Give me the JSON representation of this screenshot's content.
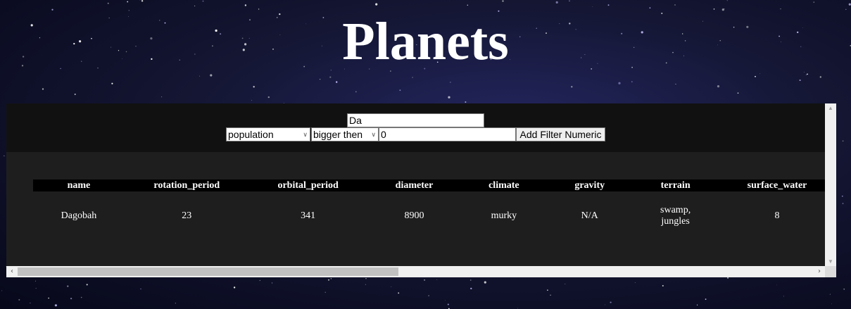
{
  "page": {
    "title": "Planets"
  },
  "filters": {
    "name_value": "Da",
    "column_selected": "population",
    "comparison_selected": "bigger then",
    "value": "0",
    "add_button_label": "Add Filter Numeric"
  },
  "table": {
    "headers": [
      "name",
      "rotation_period",
      "orbital_period",
      "diameter",
      "climate",
      "gravity",
      "terrain",
      "surface_water"
    ],
    "rows": [
      [
        "Dagobah",
        "23",
        "341",
        "8900",
        "murky",
        "N/A",
        "swamp, jungles",
        "8"
      ]
    ]
  },
  "icons": {
    "dropdown": "chevron-down-icon",
    "scroll_left": "chevron-left-icon",
    "scroll_right": "chevron-right-icon",
    "scroll_up": "triangle-up-icon",
    "scroll_down": "triangle-down-icon"
  },
  "colors": {
    "panel_bg": "#1e1e1e",
    "controls_bg": "#111111",
    "header_bg": "#000000",
    "text": "#ffffff"
  }
}
